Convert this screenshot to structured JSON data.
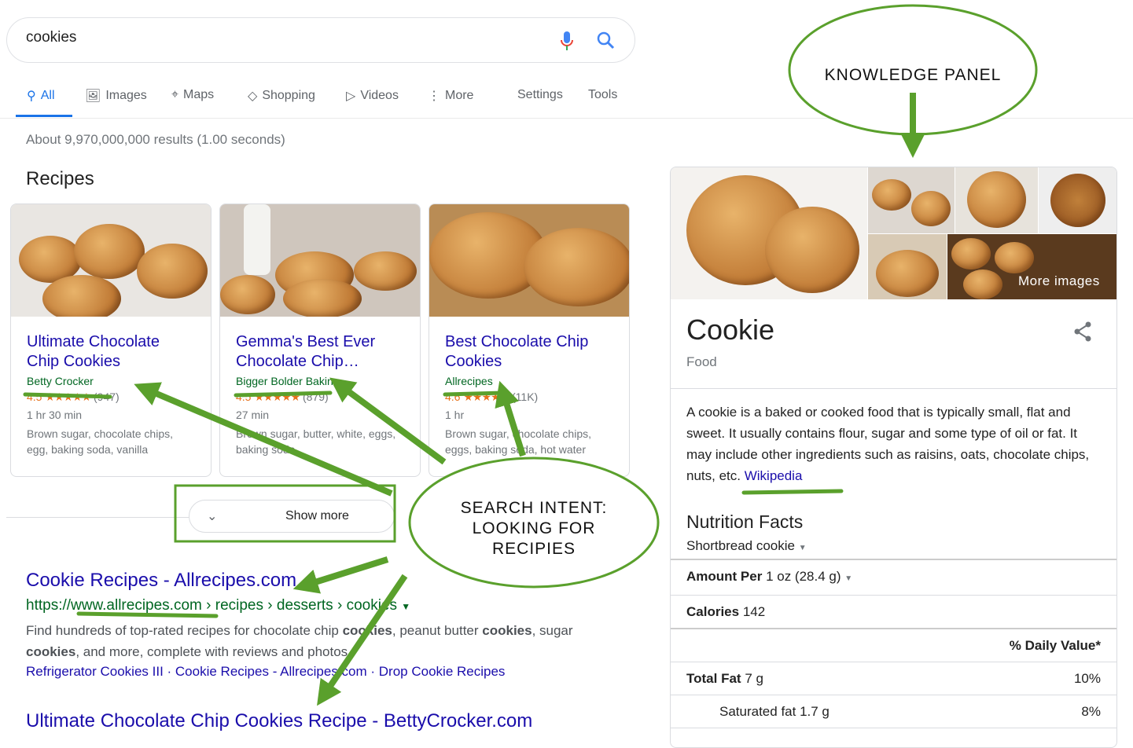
{
  "search": {
    "query": "cookies"
  },
  "tabs": [
    {
      "label": "All",
      "icon": "search-icon"
    },
    {
      "label": "Images",
      "icon": "image-icon"
    },
    {
      "label": "Maps",
      "icon": "map-icon"
    },
    {
      "label": "Shopping",
      "icon": "tag-icon"
    },
    {
      "label": "Videos",
      "icon": "play-icon"
    },
    {
      "label": "More",
      "icon": "more-vert-icon"
    }
  ],
  "settings": "Settings",
  "tools": "Tools",
  "result_stats": "About 9,970,000,000 results (1.00 seconds)",
  "recipes": {
    "heading": "Recipes",
    "show_more": "Show more",
    "cards": [
      {
        "title": "Ultimate Chocolate Chip Cookies",
        "source": "Betty Crocker",
        "rating": "4.5",
        "stars": "★★★★★",
        "count": "(947)",
        "time": "1 hr 30 min",
        "ingredients": "Brown sugar, chocolate chips, egg, baking soda, vanilla"
      },
      {
        "title": "Gemma's Best Ever Chocolate Chip…",
        "source": "Bigger Bolder Baking",
        "rating": "4.5",
        "stars": "★★★★★",
        "count": "(879)",
        "time": "27 min",
        "ingredients": "Brown sugar, butter, white, eggs, baking soda"
      },
      {
        "title": "Best Chocolate Chip Cookies",
        "source": "Allrecipes",
        "rating": "4.6",
        "stars": "★★★★★",
        "count": "(11K)",
        "time": "1 hr",
        "ingredients": "Brown sugar, chocolate chips, eggs, baking soda, hot water"
      }
    ]
  },
  "results": [
    {
      "title": "Cookie Recipes - Allrecipes.com",
      "url": "https://www.allrecipes.com › recipes › desserts › cookies",
      "snippet_html": "Find hundreds of top-rated recipes for chocolate chip <b>cookies</b>, peanut butter <b>cookies</b>, sugar <b>cookies</b>, and more, complete with reviews and photos.",
      "sitelinks": [
        "Refrigerator Cookies III",
        "Cookie Recipes - Allrecipes.com",
        "Drop Cookie Recipes"
      ]
    },
    {
      "title": "Ultimate Chocolate Chip Cookies Recipe - BettyCrocker.com"
    }
  ],
  "knowledge_panel": {
    "title": "Cookie",
    "subtitle": "Food",
    "more_images": "More images",
    "description": "A cookie is a baked or cooked food that is typically small, flat and sweet. It usually contains flour, sugar and some type of oil or fat. It may include other ingredients such as raisins, oats, chocolate chips, nuts, etc.",
    "wiki": "Wikipedia",
    "nutrition": {
      "heading": "Nutrition Facts",
      "variant": "Shortbread cookie",
      "amount_label": "Amount Per",
      "amount_value": "1 oz (28.4 g)",
      "calories_label": "Calories",
      "calories_value": "142",
      "dv_header": "% Daily Value*",
      "rows": [
        {
          "label": "Total Fat",
          "value": "7 g",
          "dv": "10%"
        },
        {
          "label": "Saturated fat",
          "value": "1.7 g",
          "dv": "8%"
        }
      ]
    }
  },
  "annotations": {
    "kp": "KNOWLEDGE PANEL",
    "intent_lines": [
      "SEARCH INTENT:",
      "LOOKING FOR",
      "RECIPIES"
    ],
    "color": "#5aa02c"
  }
}
